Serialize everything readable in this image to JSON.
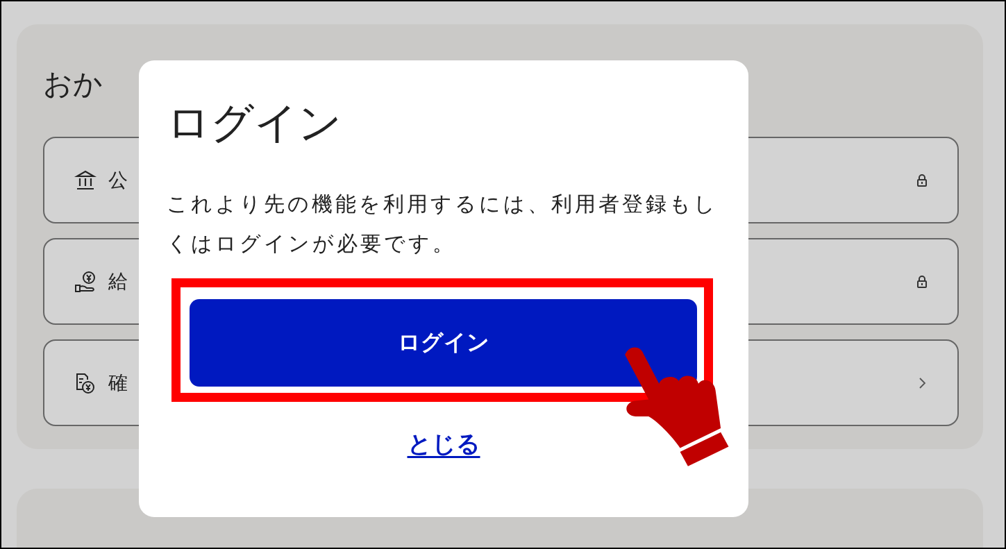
{
  "background": {
    "heading": "おか",
    "rows": [
      {
        "label": "公",
        "locked": true
      },
      {
        "label": "給",
        "locked": true
      },
      {
        "label": "確",
        "locked": false
      }
    ]
  },
  "dialog": {
    "title": "ログイン",
    "message": "これより先の機能を利用するには、利用者登録もしくはログインが必要です。",
    "primary_button": "ログイン",
    "close_link": "とじる"
  }
}
